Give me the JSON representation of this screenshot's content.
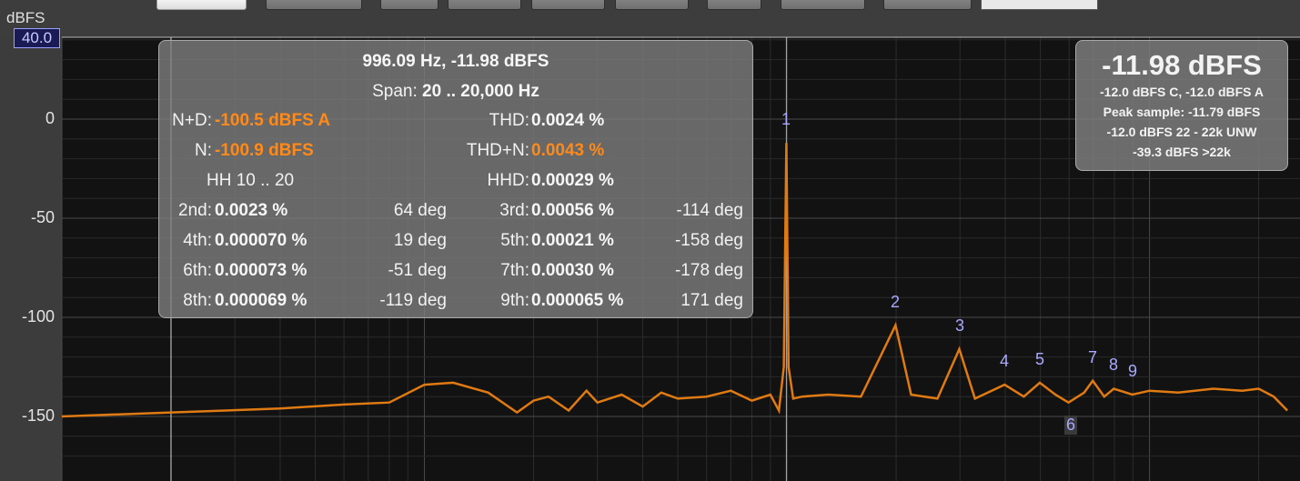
{
  "toolbar": {
    "buttons": [
      {
        "name": "toolbar-button-1",
        "active": true
      },
      {
        "name": "toolbar-button-2",
        "active": false
      },
      {
        "name": "toolbar-button-3",
        "active": false
      },
      {
        "name": "toolbar-button-4",
        "active": false
      },
      {
        "name": "toolbar-button-5",
        "active": false
      },
      {
        "name": "toolbar-button-6",
        "active": false
      },
      {
        "name": "toolbar-button-7",
        "active": false
      },
      {
        "name": "toolbar-button-8",
        "active": false
      },
      {
        "name": "toolbar-button-9",
        "active": false
      },
      {
        "name": "toolbar-field",
        "active": false
      }
    ]
  },
  "y_axis": {
    "unit": "dBFS",
    "range_value": "40.0",
    "ticks": [
      "0",
      "-50",
      "-100",
      "-150"
    ]
  },
  "info": {
    "fundamental": "996.09 Hz, -11.98 dBFS",
    "span_label": "Span:",
    "span_value": "20 .. 20,000 Hz",
    "nd_label": "N+D:",
    "nd_value": "-100.5 dBFS A",
    "thd_label": "THD:",
    "thd_value": "0.0024 %",
    "n_label": "N:",
    "n_value": "-100.9 dBFS",
    "thdn_label": "THD+N:",
    "thdn_value": "0.0043 %",
    "hh_label": "HH 10 .. 20",
    "hhd_label": "HHD:",
    "hhd_value": "0.00029 %",
    "harmonics_left": [
      {
        "label": "2nd:",
        "value": "0.0023 %",
        "phase": "64 deg"
      },
      {
        "label": "4th:",
        "value": "0.000070 %",
        "phase": "19 deg"
      },
      {
        "label": "6th:",
        "value": "0.000073 %",
        "phase": "-51 deg"
      },
      {
        "label": "8th:",
        "value": "0.000069 %",
        "phase": "-119 deg"
      }
    ],
    "harmonics_right": [
      {
        "label": "3rd:",
        "value": "0.00056 %",
        "phase": "-114 deg"
      },
      {
        "label": "5th:",
        "value": "0.00021 %",
        "phase": "-158 deg"
      },
      {
        "label": "7th:",
        "value": "0.00030 %",
        "phase": "-178 deg"
      },
      {
        "label": "9th:",
        "value": "0.000065 %",
        "phase": "171 deg"
      }
    ]
  },
  "peak": {
    "level": "-11.98 dBFS",
    "line1": "-12.0 dBFS C, -12.0 dBFS A",
    "line2": "Peak sample: -11.79 dBFS",
    "line3": "-12.0 dBFS 22 - 22k UNW",
    "line4": "-39.3 dBFS >22k"
  },
  "colors": {
    "spectrum": "#e07a12",
    "plot_background": "#121212",
    "harmonic_label": "#a9a9ff",
    "highlight_value": "#ff8a1a"
  },
  "chart_data": {
    "type": "line",
    "x_scale": "log",
    "y_unit": "dBFS",
    "ylim": [
      -170,
      40
    ],
    "grid": true,
    "series": [
      {
        "x": [
          10,
          20,
          40,
          60,
          80,
          100,
          120,
          150,
          180,
          200,
          220,
          250,
          280,
          300,
          350,
          400,
          450,
          500,
          600,
          700,
          800,
          900,
          950,
          980,
          996,
          1010,
          1040,
          1100,
          1300,
          1600,
          1992,
          2200,
          2600,
          2988,
          3300,
          3984,
          4500,
          4980,
          5500,
          5976,
          6600,
          6972,
          7500,
          7968,
          8964,
          10000,
          12000,
          15000,
          18000,
          20000,
          22000,
          24000
        ],
        "y": [
          -150,
          -148,
          -146,
          -144,
          -143,
          -134,
          -133,
          -138,
          -148,
          -142,
          -140,
          -147,
          -137,
          -143,
          -139,
          -145,
          -138,
          -141,
          -140,
          -137,
          -142,
          -139,
          -147,
          -125,
          -12,
          -125,
          -141,
          -140,
          -139,
          -140,
          -104,
          -139,
          -141,
          -116,
          -141,
          -134,
          -140,
          -133,
          -139,
          -143,
          -138,
          -132,
          -140,
          -136,
          -139,
          -137,
          -138,
          -136,
          -137,
          -136,
          -140,
          -147
        ]
      }
    ],
    "harmonic_markers": [
      {
        "label": "1",
        "x": 996,
        "y": -12
      },
      {
        "label": "2",
        "x": 1992,
        "y": -104
      },
      {
        "label": "3",
        "x": 2988,
        "y": -116
      },
      {
        "label": "4",
        "x": 3984,
        "y": -134
      },
      {
        "label": "5",
        "x": 4980,
        "y": -133
      },
      {
        "label": "6",
        "x": 5976,
        "y": -143
      },
      {
        "label": "7",
        "x": 6972,
        "y": -132
      },
      {
        "label": "8",
        "x": 7968,
        "y": -136
      },
      {
        "label": "9",
        "x": 8964,
        "y": -139
      }
    ]
  }
}
